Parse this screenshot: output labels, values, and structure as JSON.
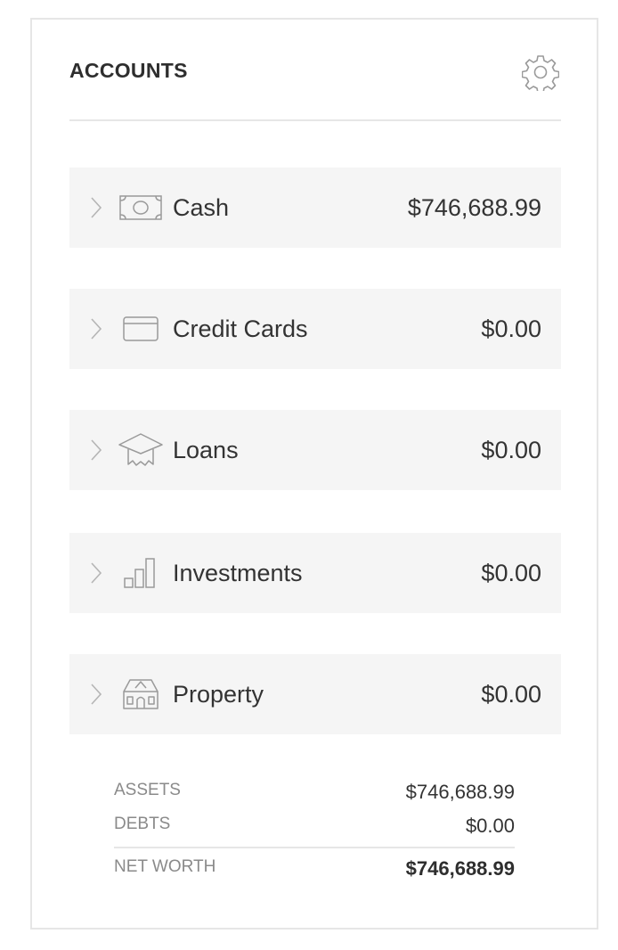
{
  "header": {
    "title": "ACCOUNTS",
    "settings_icon": "gear-icon"
  },
  "accounts": [
    {
      "label": "Cash",
      "value": "$746,688.99",
      "icon": "cash-icon"
    },
    {
      "label": "Credit Cards",
      "value": "$0.00",
      "icon": "credit-card-icon"
    },
    {
      "label": "Loans",
      "value": "$0.00",
      "icon": "graduation-cap-icon"
    },
    {
      "label": "Investments",
      "value": "$0.00",
      "icon": "bar-chart-icon"
    },
    {
      "label": "Property",
      "value": "$0.00",
      "icon": "house-icon"
    }
  ],
  "summary": {
    "assets_label": "ASSETS",
    "assets_value": "$746,688.99",
    "debts_label": "DEBTS",
    "debts_value": "$0.00",
    "net_worth_label": "NET WORTH",
    "net_worth_value": "$746,688.99"
  },
  "colors": {
    "row_background": "#f5f5f5",
    "border": "#e6e6e6",
    "icon_stroke": "#9a9a9a",
    "muted_text": "#8a8a8a"
  }
}
